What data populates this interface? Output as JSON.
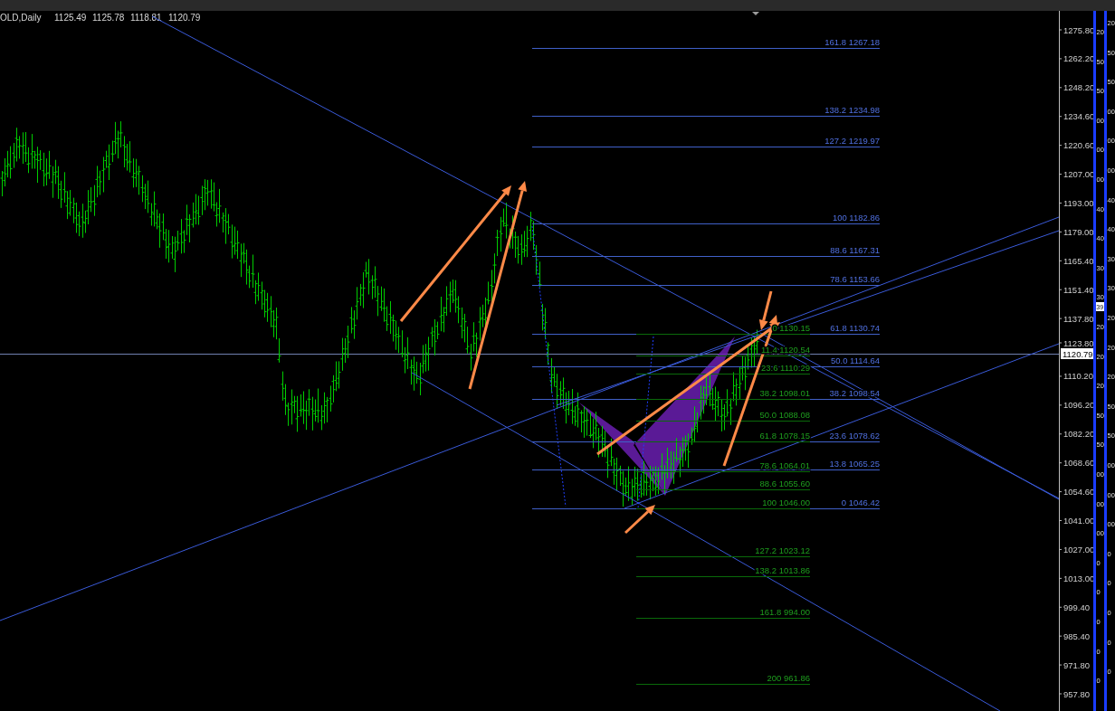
{
  "header": {
    "symbol": "OLD,Daily",
    "quotes": [
      "1125.49",
      "1125.78",
      "1118.81",
      "1120.79"
    ]
  },
  "price_axis": {
    "labels": [
      "1275.80",
      "1262.20",
      "1248.20",
      "1234.60",
      "1220.60",
      "1207.00",
      "1193.00",
      "1179.00",
      "1165.40",
      "1151.40",
      "1137.80",
      "1123.80",
      "1110.20",
      "1096.20",
      "1082.20",
      "1068.60",
      "1054.60",
      "1041.00",
      "1027.00",
      "1013.00",
      "999.40",
      "985.40",
      "971.80",
      "957.80"
    ],
    "current_price": "1120.79"
  },
  "fib_blue": {
    "levels": [
      "161.8 1267.18",
      "138.2 1234.98",
      "127.2 1219.97",
      "100 1182.86",
      "88.6 1167.31",
      "78.6 1153.66",
      "61.8 1130.74",
      "50.0 1114.64",
      "38.2 1098.54",
      "23.6 1078.62",
      "13.8 1065.25",
      "0 1046.42"
    ]
  },
  "fib_green": {
    "levels": [
      "0 1130.15",
      "11.4 1120.54",
      "23.6 1110.29",
      "38.2 1098.01",
      "50.0 1088.08",
      "61.8 1078.15",
      "78.6 1064.01",
      "88.6 1055.60",
      "100 1046.00",
      "127.2 1023.12",
      "138.2 1013.86",
      "161.8 994.00",
      "200 961.86"
    ]
  },
  "indicator_scale": {
    "column_1": [
      "20",
      "50",
      "50",
      "00",
      "00",
      "00",
      "40",
      "40",
      "30",
      "30",
      "20",
      "20",
      "20",
      "50",
      "50",
      "00",
      "00",
      "00",
      "0",
      "0",
      "0",
      "0",
      "0"
    ],
    "column_2": [
      "20",
      "50",
      "50",
      "00",
      "00",
      "00",
      "40",
      "40",
      "30",
      "30",
      "20",
      "20",
      "20",
      "50",
      "50",
      "00",
      "00",
      "00",
      "0",
      "0",
      "0",
      "0",
      "0"
    ],
    "marker": "39"
  }
}
